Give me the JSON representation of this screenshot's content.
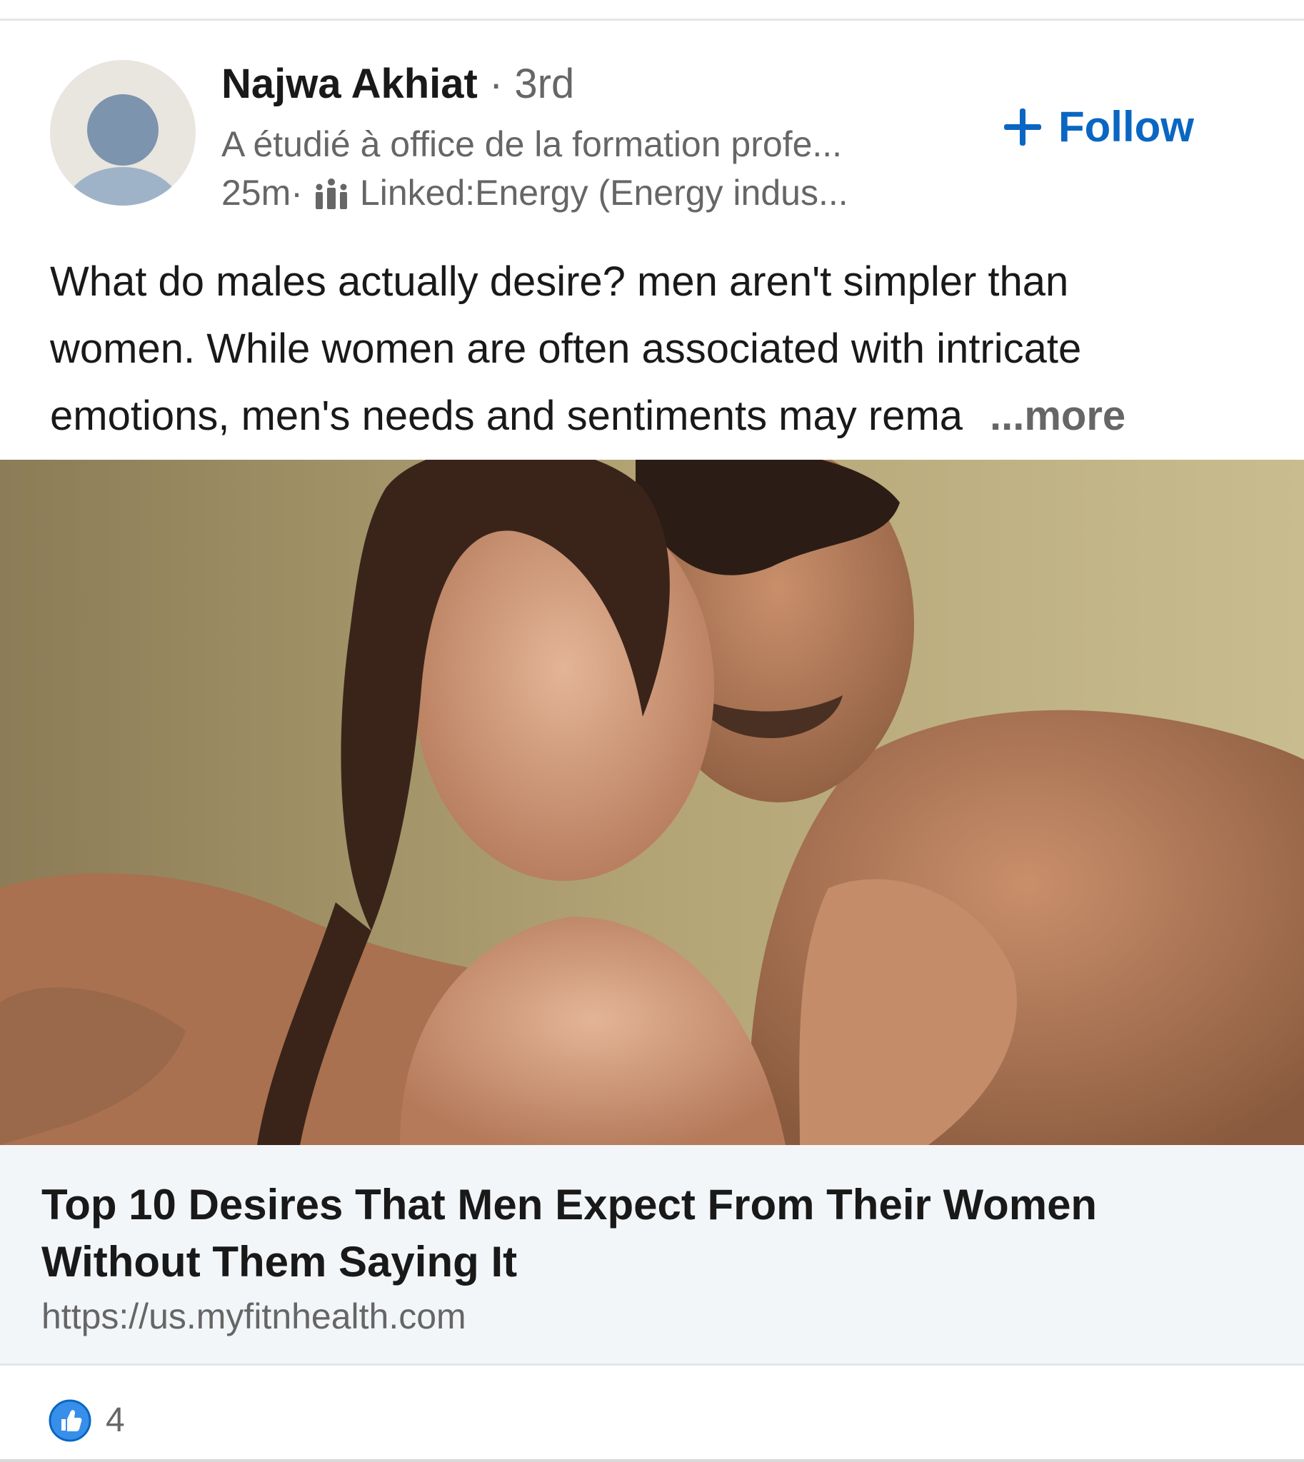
{
  "post": {
    "author": {
      "name": "Najwa Akhiat",
      "separator": " · ",
      "degree": "3rd",
      "headline": "A étudié à office de la formation profe...",
      "time": "25m",
      "meta_separator": " · ",
      "group": "Linked:Energy (Energy indus..."
    },
    "follow_label": "Follow",
    "text_lines": [
      "What do males actually desire?  men aren't simpler than",
      "women. While women are often associated with intricate",
      "emotions, men's needs and sentiments may rema"
    ],
    "more_label": "...more",
    "link_card": {
      "title": "Top 10 Desires That Men Expect From Their Women Without Them Saying It",
      "url": "https://us.myfitnhealth.com"
    },
    "reactions": {
      "count": "4"
    }
  },
  "icons": {
    "avatar": "default-avatar",
    "group": "group-people-icon",
    "follow": "plus-icon",
    "reaction": "like-icon"
  },
  "colors": {
    "accent": "#0a66c2",
    "text": "#191919",
    "muted": "#666666",
    "card_background": "#f3f6f8"
  }
}
